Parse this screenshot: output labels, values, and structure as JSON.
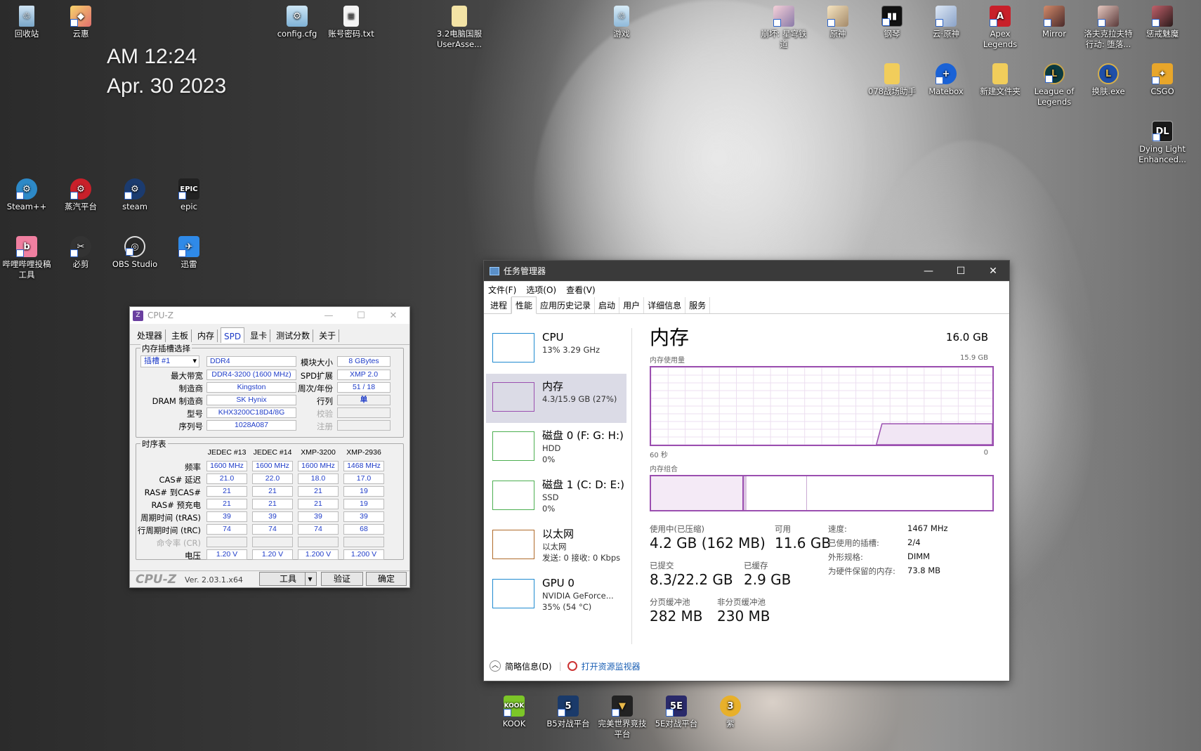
{
  "clock": {
    "time": "AM 12:24",
    "date": "Apr. 30 2023"
  },
  "desktop_icons": {
    "recycle": "回收站",
    "yunhui": "云惠",
    "config": "config.cfg",
    "account": "账号密码.txt",
    "userasse": "3.2电脑国服\nUserAsse...",
    "games": "游戏",
    "honkai": "崩坏: 星穹铁\n道",
    "yuanshen": "原神",
    "piano": "钢琴",
    "cloud_yuanshen": "云·原神",
    "apex": "Apex\nLegends",
    "mirror": "Mirror",
    "dolls": "洛夫克拉夫特\n行动: 堕落...",
    "dislike": "惩戒魅魔",
    "helper078": "078战场助手",
    "matebox": "Matebox",
    "newfolder": "新建文件夹",
    "lol": "League of\nLegends",
    "skin": "换肤.exe",
    "csgo": "CSGO",
    "dying": "Dying Light\nEnhanced...",
    "steampp": "Steam++",
    "steamcn": "蒸汽平台",
    "steam": "steam",
    "epic": "epic",
    "bili": "哔哩哔哩投稿\n工具",
    "bijian": "必剪",
    "obs": "OBS Studio",
    "xunlei": "迅雷",
    "kook": "KOOK",
    "b5": "B5对战平台",
    "wanmei": "完美世界竞技\n平台",
    "s5e": "5E对战平台",
    "gold": "紫"
  },
  "cpuz": {
    "title": "CPU-Z",
    "tabs": [
      "处理器",
      "主板",
      "内存",
      "SPD",
      "显卡",
      "测试分数",
      "关于"
    ],
    "active_tab": "SPD",
    "slot_group": "内存插槽选择",
    "slot": "插槽 #1",
    "slot_type": "DDR4",
    "labels": {
      "max_bw": "最大带宽",
      "maker": "制造商",
      "dram_maker": "DRAM 制造商",
      "part": "型号",
      "serial": "序列号",
      "module_size": "模块大小",
      "spd_ext": "SPD扩展",
      "week_year": "周次/年份",
      "ranks": "行列",
      "check": "校验",
      "reg": "注册"
    },
    "values": {
      "max_bw": "DDR4-3200 (1600 MHz)",
      "maker": "Kingston",
      "dram_maker": "SK Hynix",
      "part": "KHX3200C18D4/8G",
      "serial": "1028A087",
      "module_size": "8 GBytes",
      "spd_ext": "XMP 2.0",
      "week_year": "51 / 18",
      "ranks": "单"
    },
    "timing_group": "时序表",
    "timing_headers": [
      "JEDEC #13",
      "JEDEC #14",
      "XMP-3200",
      "XMP-2936"
    ],
    "timing_rows": [
      {
        "label": "频率",
        "v": [
          "1600 MHz",
          "1600 MHz",
          "1600 MHz",
          "1468 MHz"
        ]
      },
      {
        "label": "CAS# 延迟",
        "v": [
          "21.0",
          "22.0",
          "18.0",
          "17.0"
        ]
      },
      {
        "label": "RAS# 到CAS#",
        "v": [
          "21",
          "21",
          "21",
          "19"
        ]
      },
      {
        "label": "RAS# 预充电",
        "v": [
          "21",
          "21",
          "21",
          "19"
        ]
      },
      {
        "label": "周期时间 (tRAS)",
        "v": [
          "39",
          "39",
          "39",
          "39"
        ]
      },
      {
        "label": "行周期时间 (tRC)",
        "v": [
          "74",
          "74",
          "74",
          "68"
        ]
      },
      {
        "label": "命令率 (CR)",
        "v": [
          "",
          "",
          "",
          ""
        ]
      },
      {
        "label": "电压",
        "v": [
          "1.20 V",
          "1.20 V",
          "1.200 V",
          "1.200 V"
        ]
      }
    ],
    "footer_logo": "CPU-Z",
    "version": "Ver. 2.03.1.x64",
    "tools_btn": "工具",
    "validate_btn": "验证",
    "ok_btn": "确定"
  },
  "taskmgr": {
    "title": "任务管理器",
    "menu": [
      "文件(F)",
      "选项(O)",
      "查看(V)"
    ],
    "tabs": [
      "进程",
      "性能",
      "应用历史记录",
      "启动",
      "用户",
      "详细信息",
      "服务"
    ],
    "active_tab": "性能",
    "side": [
      {
        "name": "CPU",
        "d1": "13% 3.29 GHz",
        "d2": "",
        "color": "#1f8ad0"
      },
      {
        "name": "内存",
        "d1": "4.3/15.9 GB (27%)",
        "d2": "",
        "color": "#9b4fb0"
      },
      {
        "name": "磁盘 0 (F: G: H:)",
        "d1": "HDD",
        "d2": "0%",
        "color": "#4caf50"
      },
      {
        "name": "磁盘 1 (C: D: E:)",
        "d1": "SSD",
        "d2": "0%",
        "color": "#4caf50"
      },
      {
        "name": "以太网",
        "d1": "以太网",
        "d2": "发送: 0 接收: 0 Kbps",
        "color": "#b06a2a"
      },
      {
        "name": "GPU 0",
        "d1": "NVIDIA GeForce...",
        "d2": "35% (54 °C)",
        "color": "#1f8ad0"
      }
    ],
    "selected": "内存",
    "main_title": "内存",
    "capacity": "16.0 GB",
    "usage_label": "内存使用量",
    "usage_max": "15.9 GB",
    "axis_left": "60 秒",
    "axis_right": "0",
    "composition_label": "内存组合",
    "usage_fraction": 0.27,
    "stats": {
      "in_use_label": "使用中(已压缩)",
      "in_use": "4.2 GB (162 MB)",
      "avail_label": "可用",
      "avail": "11.6 GB",
      "committed_label": "已提交",
      "committed": "8.3/22.2 GB",
      "cached_label": "已缓存",
      "cached": "2.9 GB",
      "paged_label": "分页缓冲池",
      "paged": "282 MB",
      "nonpaged_label": "非分页缓冲池",
      "nonpaged": "230 MB"
    },
    "props": [
      {
        "k": "速度:",
        "v": "1467 MHz"
      },
      {
        "k": "已使用的插槽:",
        "v": "2/4"
      },
      {
        "k": "外形规格:",
        "v": "DIMM"
      },
      {
        "k": "为硬件保留的内存:",
        "v": "73.8 MB"
      }
    ],
    "footer_less": "简略信息(D)",
    "footer_monitor": "打开资源监视器"
  }
}
